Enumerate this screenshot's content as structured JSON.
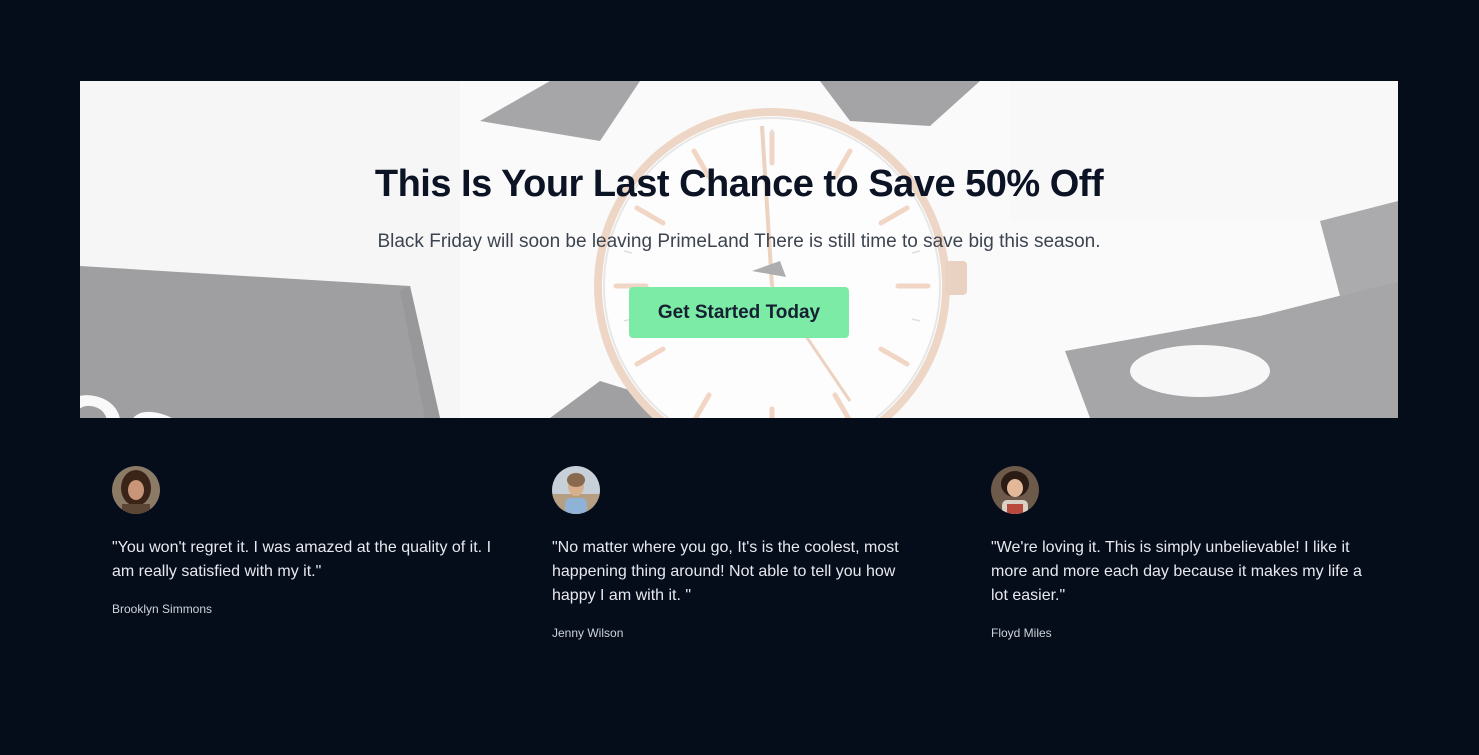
{
  "hero": {
    "title": "This Is Your Last Chance to Save 50% Off",
    "subtitle": "Black Friday will soon be leaving PrimeLand There is still time to save big this season.",
    "cta_label": "Get Started Today",
    "cta_color": "#7beba5"
  },
  "testimonials": [
    {
      "quote": "\"You won't regret it. I was amazed at the quality of it. I am really satisfied with my it.\"",
      "author": "Brooklyn Simmons"
    },
    {
      "quote": "\"No matter where you go, It's is the coolest, most happening thing around! Not able to tell you how happy I am with it. \"",
      "author": "Jenny Wilson"
    },
    {
      "quote": "\"We're loving it. This is simply unbelievable! I like it more and more each day because it makes my life a lot easier.\"",
      "author": "Floyd Miles"
    }
  ],
  "colors": {
    "page_background": "#050c1a",
    "title_text": "#0b1324",
    "quote_text": "#e7e9ee"
  }
}
